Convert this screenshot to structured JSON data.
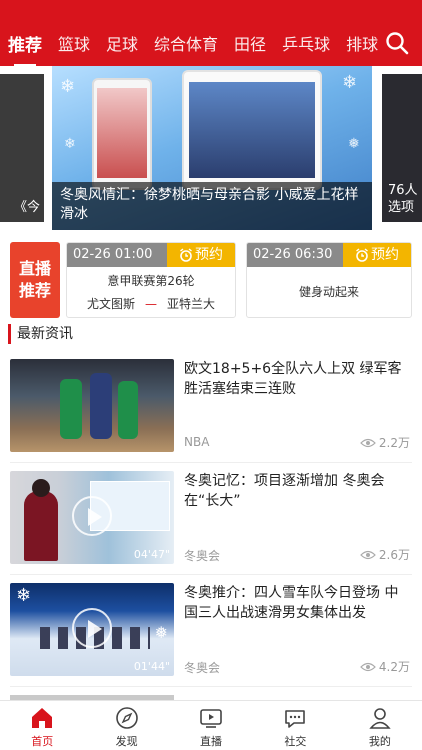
{
  "topnav": {
    "tabs": [
      {
        "label": "推荐",
        "active": true
      },
      {
        "label": "篮球"
      },
      {
        "label": "足球"
      },
      {
        "label": "综合体育"
      },
      {
        "label": "田径"
      },
      {
        "label": "乒乓球"
      },
      {
        "label": "排球"
      }
    ],
    "search_icon": "search-icon"
  },
  "banner": {
    "left_caption": "《今",
    "main_caption": "冬奥风情汇：徐梦桃晒与母亲合影 小威爱上花样滑冰",
    "right_caption": "76人 选项"
  },
  "live": {
    "badge_line1": "直播",
    "badge_line2": "推荐",
    "cards": [
      {
        "time": "02-26 01:00",
        "reserve": "预约",
        "league": "意甲联赛第26轮",
        "home": "尤文图斯",
        "away": "亚特兰大"
      },
      {
        "time": "02-26 06:30",
        "reserve": "预约",
        "title": "健身动起来"
      }
    ]
  },
  "section_title": "最新资讯",
  "news": [
    {
      "title": "欧文18+5+6全队六人上双 绿军客胜活塞结束三连败",
      "source": "NBA",
      "views": "2.2万"
    },
    {
      "title": "冬奥记忆：项目逐渐增加 冬奥会在“长大”",
      "source": "冬奥会",
      "views": "2.6万",
      "duration": "04'47\""
    },
    {
      "title": "冬奥推介：四人雪车队今日登场 中国三人出战速滑男女集体出发",
      "source": "冬奥会",
      "views": "4.2万",
      "duration": "01'44\""
    }
  ],
  "tabbar": [
    {
      "label": "首页",
      "icon": "home-icon",
      "active": true
    },
    {
      "label": "发现",
      "icon": "compass-icon"
    },
    {
      "label": "直播",
      "icon": "tv-icon"
    },
    {
      "label": "社交",
      "icon": "chat-icon"
    },
    {
      "label": "我的",
      "icon": "user-icon"
    }
  ],
  "colors": {
    "brand": "#d8141c",
    "reserve": "#f3b500",
    "live_badge": "#e8432c"
  }
}
